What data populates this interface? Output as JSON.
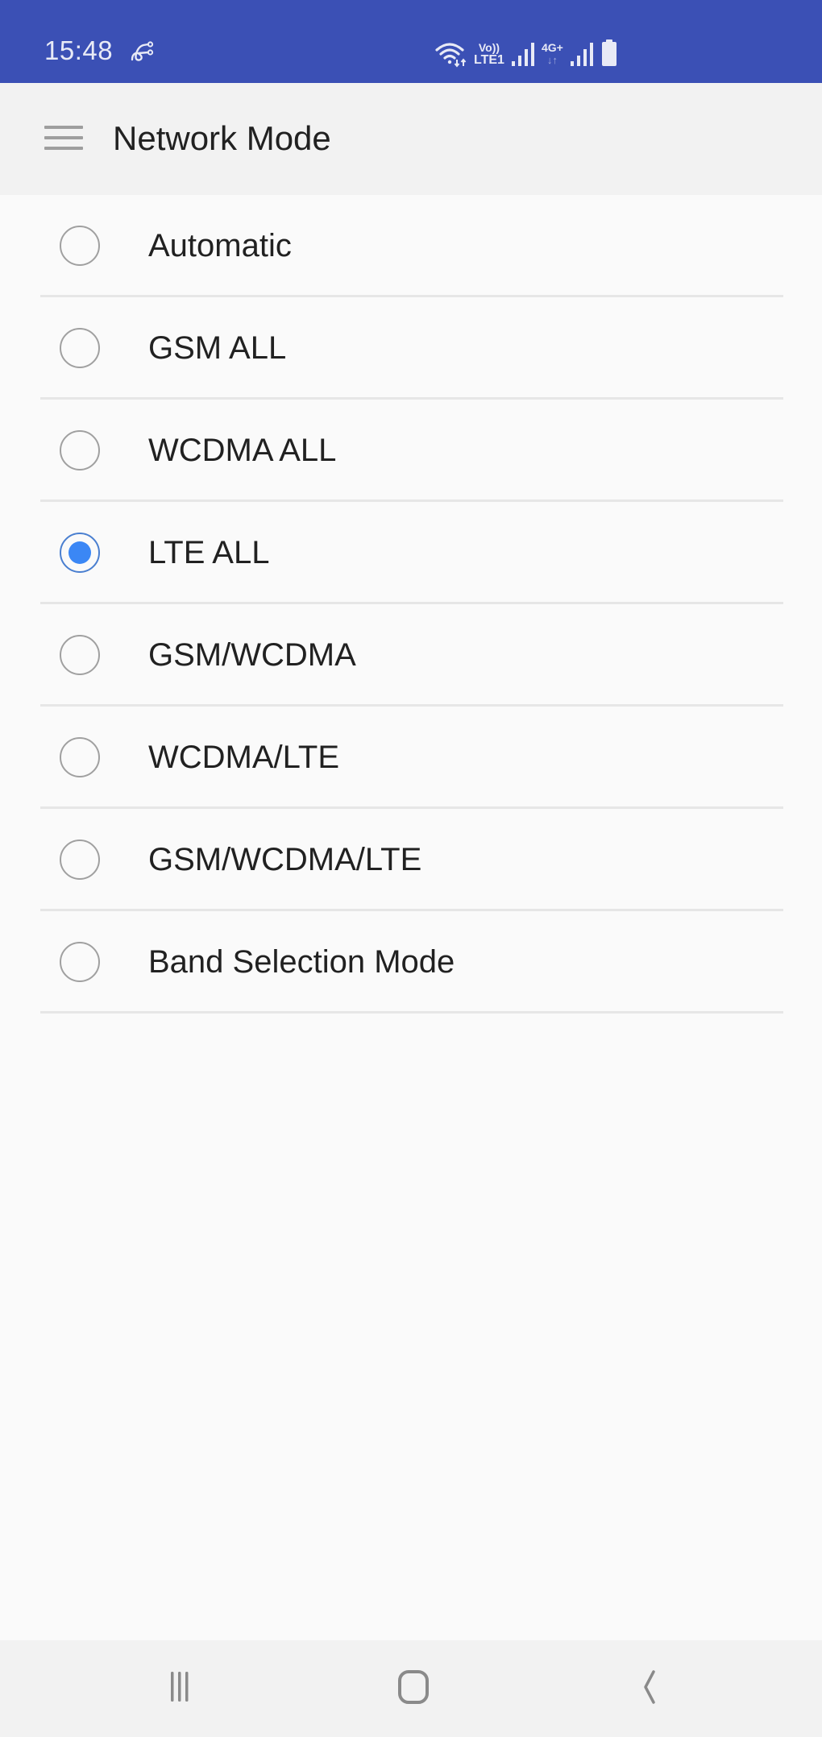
{
  "status_bar": {
    "time": "15:48",
    "left_icon": "link-icon",
    "icons": [
      "wifi-icon",
      "volte-icon",
      "signal-icon",
      "4g-plus-icon",
      "signal-icon",
      "battery-icon"
    ],
    "volte_line1": "Vo))",
    "volte_line2": "LTE1",
    "network_type": "4G+",
    "network_arrows": "↓↑"
  },
  "app_bar": {
    "menu_icon": "menu-icon",
    "title": "Network Mode"
  },
  "network_modes": {
    "selected": "LTE ALL",
    "items": [
      {
        "label": "Automatic",
        "checked": false
      },
      {
        "label": "GSM ALL",
        "checked": false
      },
      {
        "label": "WCDMA ALL",
        "checked": false
      },
      {
        "label": "LTE ALL",
        "checked": true
      },
      {
        "label": "GSM/WCDMA",
        "checked": false
      },
      {
        "label": "WCDMA/LTE",
        "checked": false
      },
      {
        "label": "GSM/WCDMA/LTE",
        "checked": false
      },
      {
        "label": "Band Selection Mode",
        "checked": false
      }
    ]
  },
  "nav_bar": {
    "recents": "recents-icon",
    "home": "home-icon",
    "back": "back-icon"
  },
  "colors": {
    "status_bar": "#3b50b5",
    "app_bar": "#f2f2f2",
    "background": "#fafafa",
    "accent": "#3b87f5"
  }
}
